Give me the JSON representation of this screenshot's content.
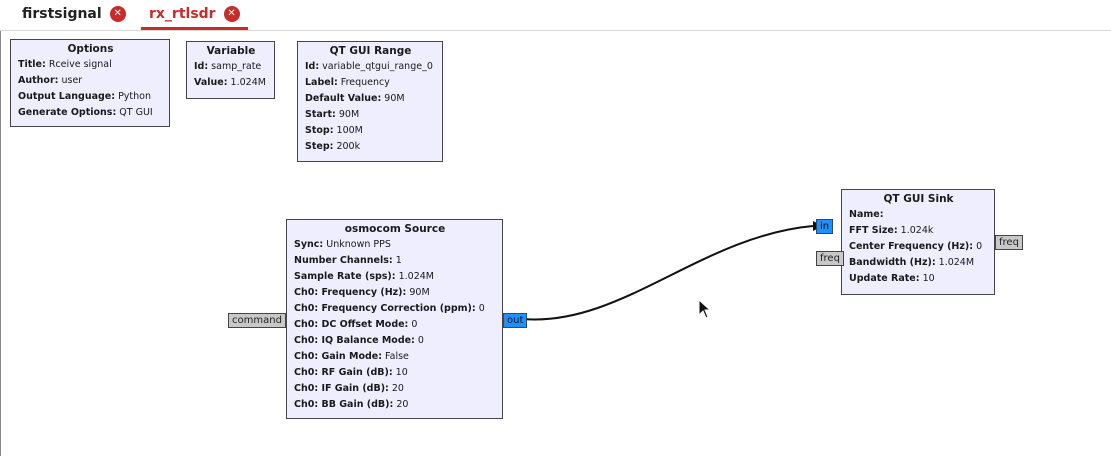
{
  "tabs": [
    {
      "label": "firstsignal",
      "active": false
    },
    {
      "label": "rx_rtlsdr",
      "active": true
    }
  ],
  "tab_close_glyph": "✕",
  "colors": {
    "accent": "#c92a2a",
    "block_bg": "#eeeeff",
    "stream_port": "#1e90ff",
    "msg_port": "#c8c8c8"
  },
  "blocks": {
    "options": {
      "title": "Options",
      "rows": [
        {
          "key": "Title:",
          "val": "Rceive signal"
        },
        {
          "key": "Author:",
          "val": "user"
        },
        {
          "key": "Output Language:",
          "val": "Python"
        },
        {
          "key": "Generate Options:",
          "val": "QT GUI"
        }
      ]
    },
    "variable": {
      "title": "Variable",
      "rows": [
        {
          "key": "Id:",
          "val": "samp_rate"
        },
        {
          "key": "Value:",
          "val": "1.024M"
        }
      ]
    },
    "range": {
      "title": "QT GUI Range",
      "rows": [
        {
          "key": "Id:",
          "val": "variable_qtgui_range_0"
        },
        {
          "key": "Label:",
          "val": "Frequency"
        },
        {
          "key": "Default Value:",
          "val": "90M"
        },
        {
          "key": "Start:",
          "val": "90M"
        },
        {
          "key": "Stop:",
          "val": "100M"
        },
        {
          "key": "Step:",
          "val": "200k"
        }
      ]
    },
    "osmocom": {
      "title": "osmocom Source",
      "rows": [
        {
          "key": "Sync:",
          "val": "Unknown PPS"
        },
        {
          "key": "Number Channels:",
          "val": "1"
        },
        {
          "key": "Sample Rate (sps):",
          "val": "1.024M"
        },
        {
          "key": "Ch0: Frequency (Hz):",
          "val": "90M"
        },
        {
          "key": "Ch0: Frequency Correction (ppm):",
          "val": "0"
        },
        {
          "key": "Ch0: DC Offset Mode:",
          "val": "0"
        },
        {
          "key": "Ch0: IQ Balance Mode:",
          "val": "0"
        },
        {
          "key": "Ch0: Gain Mode:",
          "val": "False"
        },
        {
          "key": "Ch0: RF Gain (dB):",
          "val": "10"
        },
        {
          "key": "Ch0: IF Gain (dB):",
          "val": "20"
        },
        {
          "key": "Ch0: BB Gain (dB):",
          "val": "20"
        }
      ],
      "ports": {
        "command": "command",
        "out": "out"
      }
    },
    "sink": {
      "title": "QT GUI Sink",
      "rows": [
        {
          "key": "Name:",
          "val": ""
        },
        {
          "key": "FFT Size:",
          "val": "1.024k"
        },
        {
          "key": "Center Frequency (Hz):",
          "val": "0"
        },
        {
          "key": "Bandwidth (Hz):",
          "val": "1.024M"
        },
        {
          "key": "Update Rate:",
          "val": "10"
        }
      ],
      "ports": {
        "in": "in",
        "freq_in": "freq",
        "freq_out": "freq"
      }
    }
  }
}
